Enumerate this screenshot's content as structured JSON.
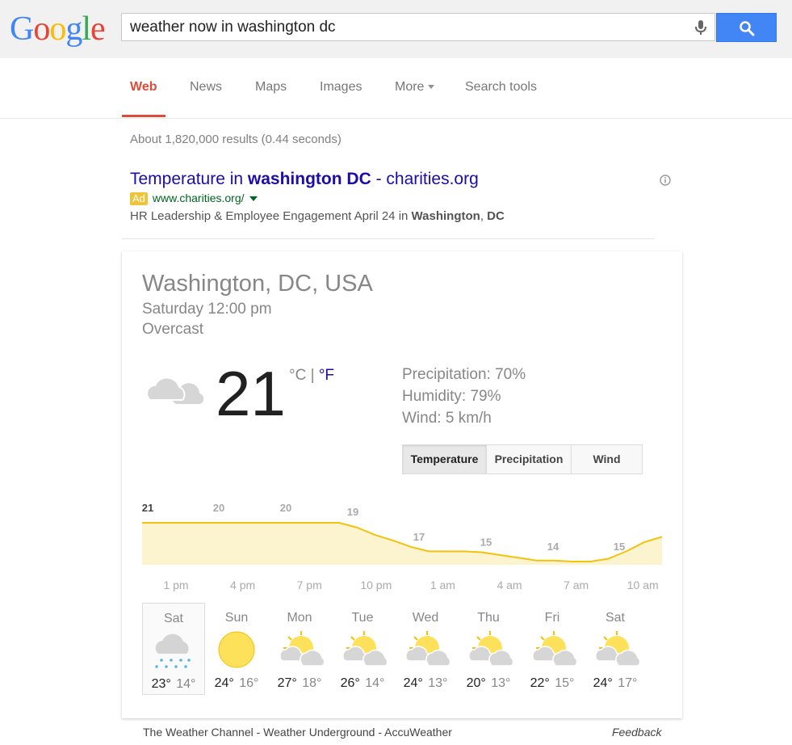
{
  "logo": {
    "letters": [
      "G",
      "o",
      "o",
      "g",
      "l",
      "e"
    ],
    "colors": [
      "#4285f4",
      "#ea4335",
      "#fbbc05",
      "#4285f4",
      "#34a853",
      "#ea4335"
    ]
  },
  "search": {
    "query": "weather now in washington dc"
  },
  "tabs": {
    "web": "Web",
    "news": "News",
    "maps": "Maps",
    "images": "Images",
    "more": "More",
    "tools": "Search tools"
  },
  "stats": "About 1,820,000 results (0.44 seconds)",
  "ad": {
    "title_pre": "Temperature in ",
    "title_bold": "washington DC",
    "title_post": " - charities.org",
    "badge": "Ad",
    "url": "www.charities.org/",
    "desc_pre": "HR Leadership & Employee Engagement April 24 in ",
    "desc_bold1": "Washington",
    "desc_sep": ", ",
    "desc_bold2": "DC"
  },
  "weather": {
    "location": "Washington, DC, USA",
    "time": "Saturday 12:00 pm",
    "condition": "Overcast",
    "current_icon": "cloud-icon",
    "temperature": "21",
    "unit_c": "°C",
    "unit_sep": " | ",
    "unit_f": "°F",
    "precipitation": "Precipitation: 70%",
    "humidity": "Humidity: 79%",
    "wind": "Wind: 5 km/h",
    "toggles": [
      "Temperature",
      "Precipitation",
      "Wind"
    ],
    "selected_toggle": "Temperature",
    "forecast": [
      {
        "day": "Sat",
        "icon": "snow-cloud-icon",
        "hi": "23°",
        "lo": "14°"
      },
      {
        "day": "Sun",
        "icon": "sun-icon",
        "hi": "24°",
        "lo": "16°"
      },
      {
        "day": "Mon",
        "icon": "partly-cloudy-icon",
        "hi": "27°",
        "lo": "18°"
      },
      {
        "day": "Tue",
        "icon": "partly-cloudy-icon",
        "hi": "26°",
        "lo": "14°"
      },
      {
        "day": "Wed",
        "icon": "partly-cloudy-icon",
        "hi": "24°",
        "lo": "13°"
      },
      {
        "day": "Thu",
        "icon": "partly-cloudy-icon",
        "hi": "20°",
        "lo": "13°"
      },
      {
        "day": "Fri",
        "icon": "partly-cloudy-icon",
        "hi": "22°",
        "lo": "15°"
      },
      {
        "day": "Sat",
        "icon": "partly-cloudy-icon",
        "hi": "24°",
        "lo": "17°"
      }
    ],
    "sources": [
      "The Weather Channel",
      "Weather Underground",
      "AccuWeather"
    ],
    "source_sep": " - ",
    "feedback": "Feedback"
  },
  "chart_data": {
    "type": "area",
    "x": [
      0,
      1,
      2,
      3,
      4,
      5,
      6,
      7,
      8,
      9,
      10,
      11,
      12,
      13,
      14,
      15,
      16,
      17,
      18,
      19,
      20,
      21,
      22,
      23
    ],
    "values": [
      21,
      20.5,
      20,
      20,
      20,
      20,
      20,
      20,
      20,
      19.8,
      19,
      18.2,
      17.6,
      16.8,
      16.2,
      15.5,
      15,
      15,
      15,
      14.9,
      14.6,
      14.3,
      14,
      14,
      13.8,
      13.5,
      14.2,
      15,
      16,
      16.6
    ],
    "labels": [
      {
        "index": 0,
        "text": "21"
      },
      {
        "index": 3,
        "text": "20"
      },
      {
        "index": 6,
        "text": "20"
      },
      {
        "index": 9,
        "text": "19"
      },
      {
        "index": 12,
        "text": "17"
      },
      {
        "index": 15,
        "text": "15"
      },
      {
        "index": 18,
        "text": "14"
      },
      {
        "index": 21,
        "text": "15"
      }
    ],
    "xticks": [
      "1 pm",
      "4 pm",
      "7 pm",
      "10 pm",
      "1 am",
      "4 am",
      "7 am",
      "10 am"
    ],
    "ylim": [
      10,
      24
    ],
    "line_color": "#f4c20d",
    "fill_color": "#fcf3cf"
  }
}
